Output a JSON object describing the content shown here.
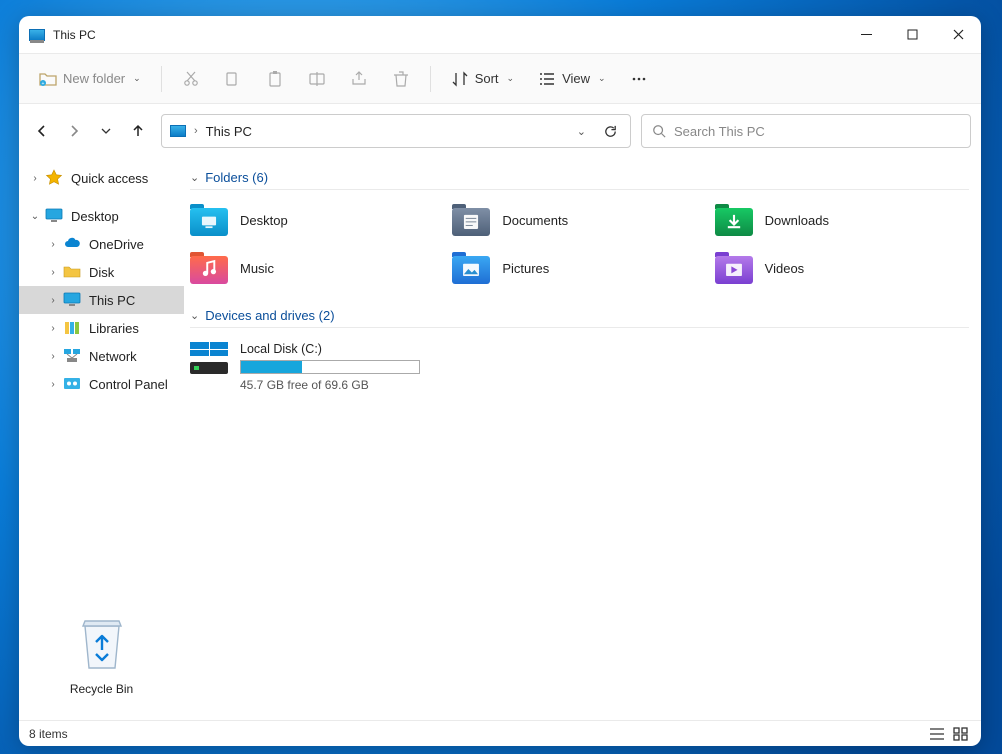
{
  "window": {
    "title": "This PC"
  },
  "toolbar": {
    "new_folder": "New folder",
    "sort": "Sort",
    "view": "View"
  },
  "address": {
    "path": "This PC"
  },
  "search": {
    "placeholder": "Search This PC"
  },
  "sidebar": {
    "quick_access": "Quick access",
    "desktop": "Desktop",
    "onedrive": "OneDrive",
    "disk": "Disk",
    "this_pc": "This PC",
    "libraries": "Libraries",
    "network": "Network",
    "control_panel": "Control Panel",
    "recycle_bin": "Recycle Bin"
  },
  "groups": {
    "folders_header": "Folders (6)",
    "drives_header": "Devices and drives (2)"
  },
  "folders": [
    {
      "name": "Desktop",
      "color_body": "linear-gradient(#26c0f0,#0a8fc9)",
      "color_tab": "#0a8fc9",
      "iname": "folder-desktop"
    },
    {
      "name": "Documents",
      "color_body": "linear-gradient(#7f8fa6,#4e6078)",
      "color_tab": "#4e6078",
      "iname": "folder-documents"
    },
    {
      "name": "Downloads",
      "color_body": "linear-gradient(#17c964,#0e8a45)",
      "color_tab": "#0e8a45",
      "iname": "folder-downloads"
    },
    {
      "name": "Music",
      "color_body": "linear-gradient(#ff6b4a,#d94aa0)",
      "color_tab": "#e05533",
      "iname": "folder-music"
    },
    {
      "name": "Pictures",
      "color_body": "linear-gradient(#3aa8f3,#1f6ed4)",
      "color_tab": "#1f6ed4",
      "iname": "folder-pictures"
    },
    {
      "name": "Videos",
      "color_body": "linear-gradient(#b47aea,#7a3fd1)",
      "color_tab": "#7a3fd1",
      "iname": "folder-videos"
    }
  ],
  "drives": [
    {
      "name": "Local Disk (C:)",
      "free_text": "45.7 GB free of 69.6 GB",
      "used_pct": 34
    }
  ],
  "status": {
    "text": "8 items"
  }
}
